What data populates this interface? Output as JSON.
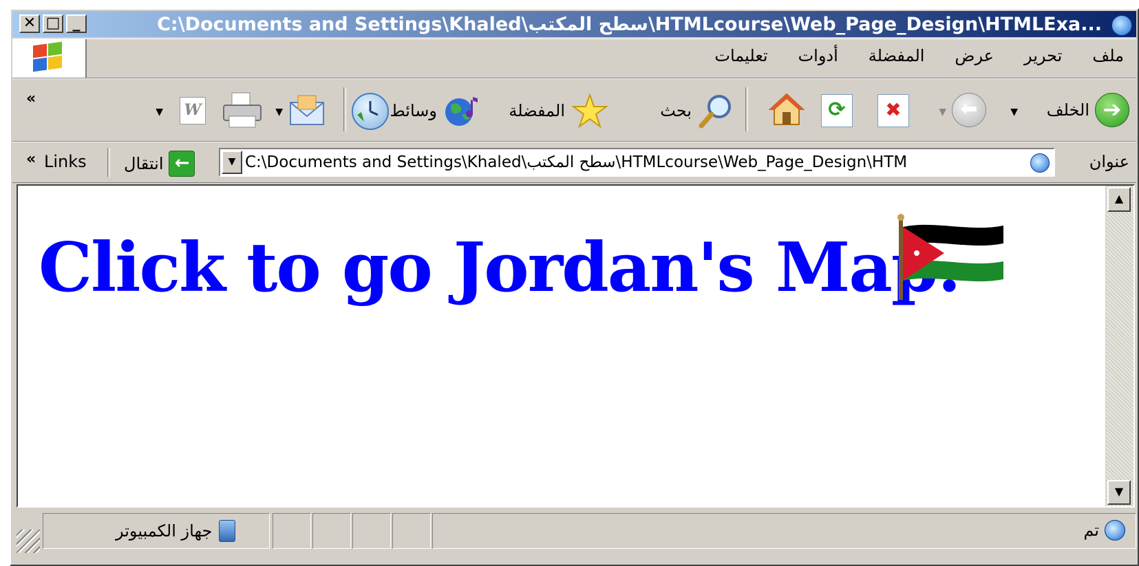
{
  "window": {
    "title": "C:\\Documents and Settings\\Khaled\\سطح المكتب\\HTMLcourse\\Web_Page_Design\\HTMLExa...",
    "controls": {
      "close": "✕",
      "maximize": "□",
      "minimize": "_"
    }
  },
  "menu": {
    "items": [
      "ملف",
      "تحرير",
      "عرض",
      "المفضلة",
      "أدوات",
      "تعليمات"
    ]
  },
  "toolbar": {
    "back": "الخلف",
    "search": "بحث",
    "favorites": "المفضلة",
    "media": "وسائط",
    "overflow": "«"
  },
  "address": {
    "label": "عنوان",
    "value": "C:\\Documents and Settings\\Khaled\\سطح المكتب\\HTMLcourse\\Web_Page_Design\\HTM",
    "go": "انتقال",
    "links": "Links",
    "overflow": "«"
  },
  "page": {
    "heading": "Click to go Jordan's Map:"
  },
  "status": {
    "done": "تم",
    "zone": "جهاز الكمبيوتر"
  },
  "colors": {
    "link": "#0000ff",
    "titlebar_start": "#0a246a",
    "titlebar_end": "#a6caf0"
  }
}
